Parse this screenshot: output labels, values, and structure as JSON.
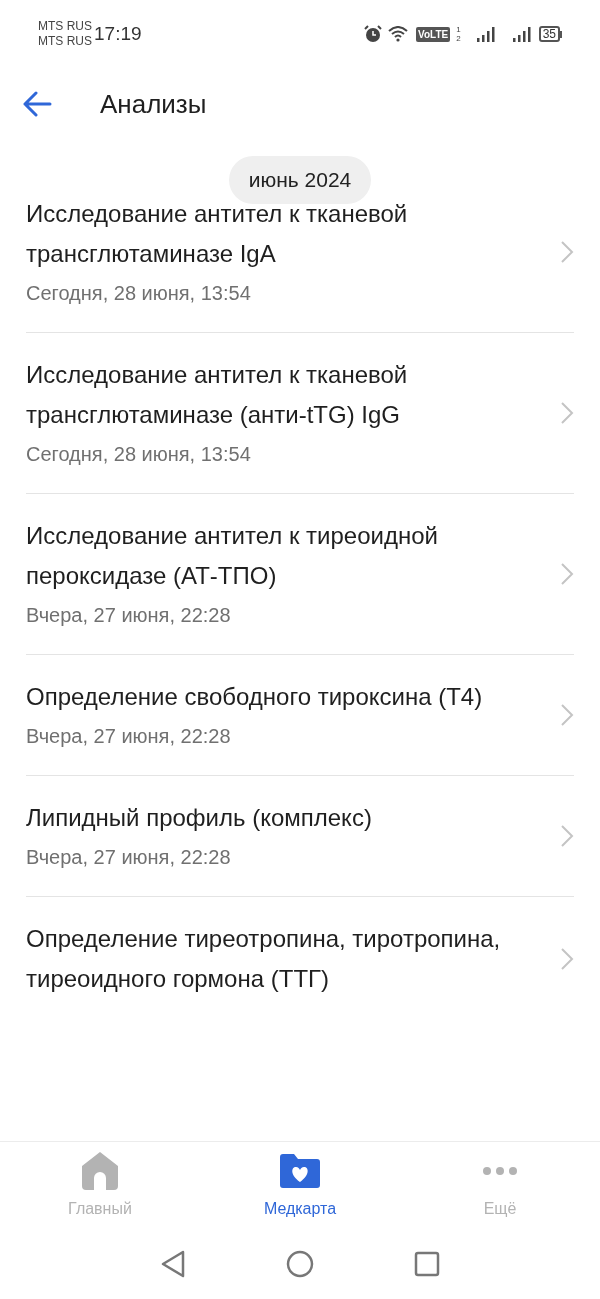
{
  "status_bar": {
    "carriers": [
      "MTS RUS",
      "MTS RUS"
    ],
    "time": "17:19",
    "volte": "VoLTE",
    "sim_labels": [
      "1",
      "2"
    ],
    "battery": "35"
  },
  "header": {
    "title": "Анализы"
  },
  "month": "июнь 2024",
  "items": [
    {
      "title": "Исследование антител к тканевой трансглютаминазе IgA",
      "date": "Сегодня, 28 июня, 13:54"
    },
    {
      "title": "Исследование антител к тканевой трансглютаминазе (анти-tTG) IgG",
      "date": "Сегодня, 28 июня, 13:54"
    },
    {
      "title": "Исследование антител к тиреоидной пероксидазе (АТ-ТПО)",
      "date": "Вчера, 27 июня, 22:28"
    },
    {
      "title": "Определение свободного тироксина (Т4)",
      "date": "Вчера, 27 июня, 22:28"
    },
    {
      "title": "Липидный профиль (комплекс)",
      "date": "Вчера, 27 июня, 22:28"
    },
    {
      "title": "Определение тиреотропина, тиротропина, тиреоидного гормона (ТТГ)"
    }
  ],
  "tabs": [
    {
      "kind": "home",
      "label": "Главный",
      "selected": false
    },
    {
      "kind": "medcard",
      "label": "Медкарта",
      "selected": true
    },
    {
      "kind": "more",
      "label": "Ещё",
      "selected": false
    }
  ]
}
